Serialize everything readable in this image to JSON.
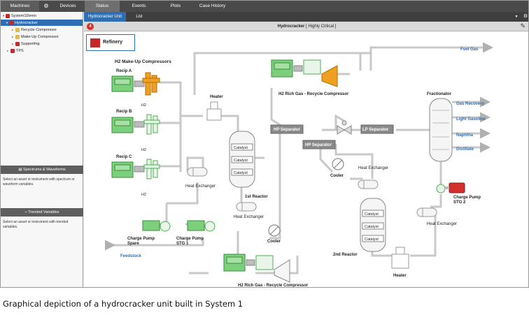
{
  "top_tabs": {
    "machines": "Machines",
    "devices": "Devices",
    "status": "Status",
    "events": "Events",
    "plots": "Plots",
    "case_history": "Case History"
  },
  "tree": [
    {
      "label": "System1Demo",
      "level": 0
    },
    {
      "label": "Hydrocracker",
      "level": 1,
      "selected": true
    },
    {
      "label": "Recycle Compressor",
      "level": 2
    },
    {
      "label": "Make-Up Compressor",
      "level": 2
    },
    {
      "label": "Supporting",
      "level": 2
    },
    {
      "label": "TPS",
      "level": 1
    }
  ],
  "spectrum_panel": {
    "title": "Spectrums & Waveforms",
    "text": "Select an asset or instrument with spectrum or waveform variables."
  },
  "trend_panel": {
    "title": "Trended Variables",
    "text": "Select an asset or instrument with trended variables."
  },
  "sub_tabs": {
    "unit": "Hydrocracker Unit",
    "list": "List"
  },
  "title_bar": {
    "alert_count": "4",
    "unit_name": "Hydrocracker",
    "severity": "[ Highly Critical ]"
  },
  "refinery_label": "Refinery",
  "diagram": {
    "h2_makeup": "H2 Make-Up Compressors",
    "recip_a": "Recip A",
    "recip_b": "Recip B",
    "recip_c": "Recip C",
    "h2_1": "H2",
    "h2_2": "H2",
    "h2_3": "H2",
    "heater_top": "Heater",
    "heat_exchanger_left": "Heat Exchanger",
    "catalyst_1": "Catalyst",
    "catalyst_2": "Catalyst",
    "catalyst_3": "Catalyst",
    "first_reactor": "1st Reactor",
    "heat_exchanger_mid": "Heat Exchanger",
    "cooler_bottom": "Cooler",
    "h2_rich_top": "H2 Rich Gas - Recycle Compressor",
    "hp_separator_1": "HP Separator",
    "hp_separator_2": "HP Separator",
    "lp_separator": "LP Separator",
    "cooler_mid": "Cooler",
    "heat_exchanger_right": "Heat Exchanger",
    "catalyst_4": "Catalyst",
    "catalyst_5": "Catalyst",
    "catalyst_6": "Catalyst",
    "second_reactor": "2nd Reactor",
    "heater_bottom": "Heater",
    "fuel_gas": "Fuel Gas",
    "fractionator": "Fractionator",
    "gas_recovery": "Gas Recovery",
    "light_gasoline": "Light Gasoline",
    "naphtha": "Naphtha",
    "distillate": "Distillate",
    "charge_pump_stg2": "Charge Pump STG 2",
    "heat_exchanger_far": "Heat Exchanger",
    "charge_pump_spare": "Charge Pump Spare",
    "charge_pump_stg1": "Charge Pump STG 1",
    "feedstock": "Feedstock",
    "h2_rich_bottom": "H2 Rich Gas - Recycle Compressor"
  },
  "caption": "Graphical depiction of a hydrocracker unit built in System 1",
  "colors": {
    "accent": "#2d6eb4",
    "alert": "#d32f2f",
    "equipment_green": "#4caf50",
    "compressor_orange": "#f0a020",
    "pipe": "#c8c8c8"
  }
}
